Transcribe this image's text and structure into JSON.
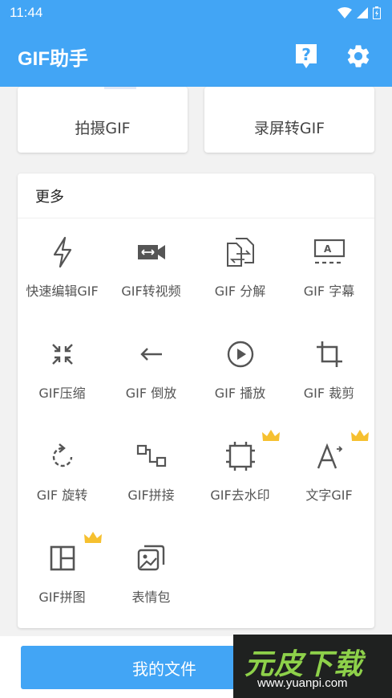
{
  "status_bar": {
    "time": "11:44"
  },
  "toolbar": {
    "title": "GIF助手"
  },
  "top_cards": [
    "拍摄GIF",
    "录屏转GIF"
  ],
  "more": {
    "header": "更多",
    "items": [
      {
        "label": "快速编辑GIF",
        "icon": "lightning-icon",
        "premium": false
      },
      {
        "label": "GIF转视频",
        "icon": "video-camera-icon",
        "premium": false
      },
      {
        "label": "GIF 分解",
        "icon": "split-pages-icon",
        "premium": false
      },
      {
        "label": "GIF 字幕",
        "icon": "subtitle-icon",
        "premium": false
      },
      {
        "label": "GIF压缩",
        "icon": "compress-icon",
        "premium": false
      },
      {
        "label": "GIF 倒放",
        "icon": "arrow-left-icon",
        "premium": false
      },
      {
        "label": "GIF 播放",
        "icon": "play-circle-icon",
        "premium": false
      },
      {
        "label": "GIF 裁剪",
        "icon": "crop-icon",
        "premium": false
      },
      {
        "label": "GIF 旋转",
        "icon": "rotate-icon",
        "premium": false
      },
      {
        "label": "GIF拼接",
        "icon": "join-icon",
        "premium": false
      },
      {
        "label": "GIF去水印",
        "icon": "watermark-remove-icon",
        "premium": true
      },
      {
        "label": "文字GIF",
        "icon": "text-icon",
        "premium": true
      },
      {
        "label": "GIF拼图",
        "icon": "collage-icon",
        "premium": true
      },
      {
        "label": "表情包",
        "icon": "gallery-icon",
        "premium": false
      }
    ]
  },
  "bottom": {
    "files_label": "我的文件"
  },
  "watermark": {
    "title": "元皮下载",
    "url": "www.yuanpi.com"
  },
  "colors": {
    "primary": "#42a5f5",
    "crown": "#f6c02f",
    "icon": "#555555"
  }
}
